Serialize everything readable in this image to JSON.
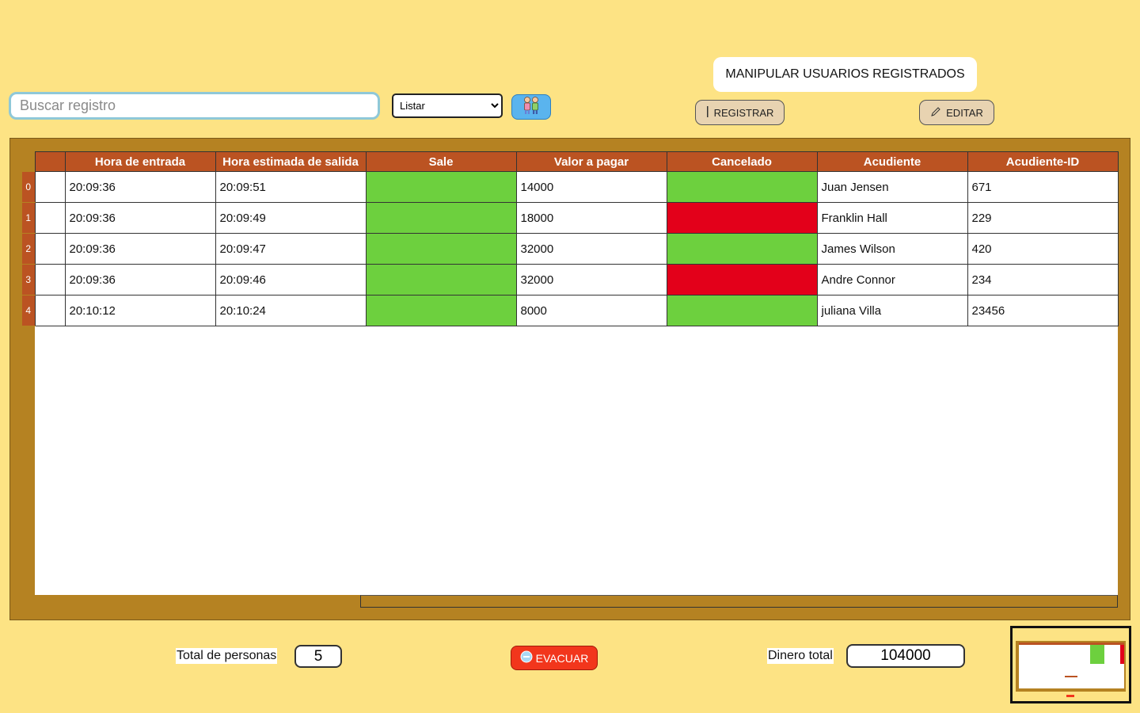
{
  "search": {
    "placeholder": "Buscar registro",
    "value": ""
  },
  "filter": {
    "selected": "Listar",
    "options": [
      "Listar"
    ]
  },
  "icons": {
    "kids": "children-icon",
    "register": "cursor-icon",
    "edit": "pencil-icon",
    "evacuate": "exit-icon"
  },
  "header": {
    "title": "MANIPULAR USUARIOS REGISTRADOS",
    "register_label": "REGISTRAR",
    "edit_label": "EDITAR"
  },
  "table": {
    "columns": [
      "",
      "Hora de entrada",
      "Hora estimada de salida",
      "Sale",
      "Valor a pagar",
      "Cancelado",
      "Acudiente",
      "Acudiente-ID"
    ],
    "rows": [
      {
        "index": "0",
        "c0": "",
        "entrada": "20:09:36",
        "salida": "20:09:51",
        "sale": "green",
        "valor": "14000",
        "cancelado": "green",
        "acudiente": "Juan Jensen",
        "id": "671"
      },
      {
        "index": "1",
        "c0": "",
        "entrada": "20:09:36",
        "salida": "20:09:49",
        "sale": "green",
        "valor": "18000",
        "cancelado": "red",
        "acudiente": "Franklin Hall",
        "id": "229"
      },
      {
        "index": "2",
        "c0": "",
        "entrada": "20:09:36",
        "salida": "20:09:47",
        "sale": "green",
        "valor": "32000",
        "cancelado": "green",
        "acudiente": "James Wilson",
        "id": "420"
      },
      {
        "index": "3",
        "c0": "",
        "entrada": "20:09:36",
        "salida": "20:09:46",
        "sale": "green",
        "valor": "32000",
        "cancelado": "red",
        "acudiente": "Andre Connor",
        "id": "234"
      },
      {
        "index": "4",
        "c0": "",
        "entrada": "20:10:12",
        "salida": "20:10:24",
        "sale": "green",
        "valor": "8000",
        "cancelado": "green",
        "acudiente": "juliana Villa",
        "id": "23456"
      }
    ]
  },
  "footer": {
    "persons_label": "Total de personas",
    "persons_value": "5",
    "evacuate_label": "EVACUAR",
    "money_label": "Dinero total",
    "money_value": "104000"
  },
  "colors": {
    "background": "#fde384",
    "panel": "#b58222",
    "header": "#bb5322",
    "status_ok": "#6dd03e",
    "status_bad": "#e3001a",
    "evacuate": "#f2361c"
  }
}
